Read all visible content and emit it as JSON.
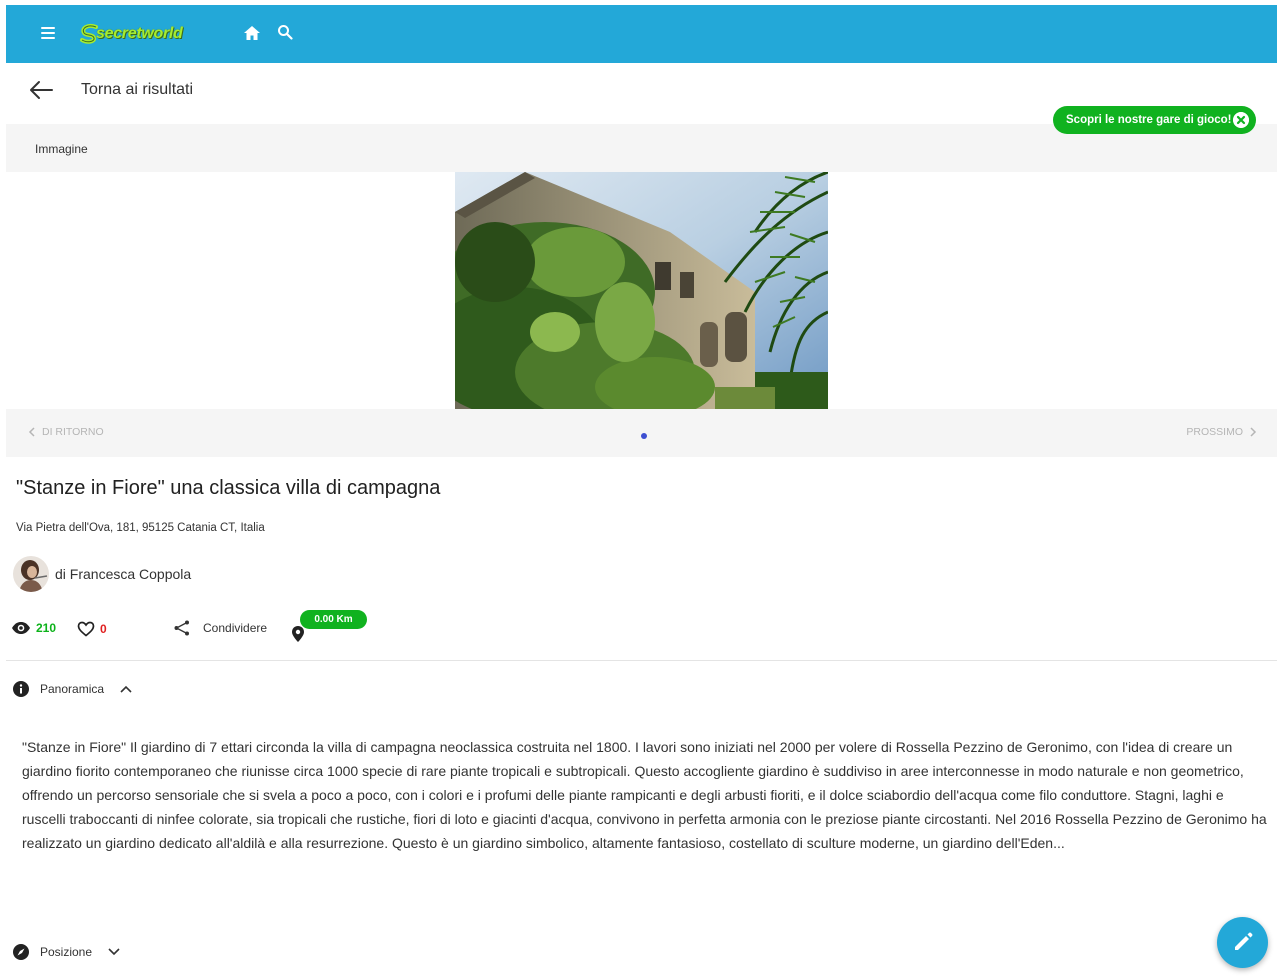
{
  "app": {
    "logo_text": "secretworld"
  },
  "header": {
    "icons": [
      "menu-icon",
      "home-icon",
      "search-icon"
    ]
  },
  "nav": {
    "back_label": "Torna ai risultati"
  },
  "promo": {
    "label": "Scopri le nostre gare di gioco!"
  },
  "gallery": {
    "title": "Immagine",
    "prev_label": "DI RITORNO",
    "next_label": "PROSSIMO",
    "image_alt": "Villa Stanze in Fiore"
  },
  "place": {
    "title": "\"Stanze in Fiore\" una classica villa di campagna",
    "address": "Via Pietra dell'Ova, 181, 95125 Catania CT, Italia",
    "author": "di Francesca Coppola"
  },
  "stats": {
    "views": "210",
    "likes": "0",
    "share_label": "Condividere",
    "distance": "0.00 Km"
  },
  "sections": {
    "overview_label": "Panoramica",
    "position_label": "Posizione",
    "description": "\"Stanze in Fiore\" Il giardino di 7 ettari circonda la villa di campagna neoclassica costruita nel 1800. I lavori sono iniziati nel 2000 per volere di Rossella Pezzino de Geronimo, con l'idea di creare un giardino fiorito contemporaneo che riunisse circa 1000 specie di rare piante tropicali e subtropicali. Questo accogliente giardino è suddiviso in aree interconnesse in modo naturale e non geometrico, offrendo un percorso sensoriale che si svela a poco a poco, con i colori e i profumi delle piante rampicanti e degli arbusti fioriti, e il dolce sciabordio dell'acqua come filo conduttore. Stagni, laghi e ruscelli traboccanti di ninfee colorate, sia tropicali che rustiche, fiori di loto e giacinti d'acqua, convivono in perfetta armonia con le preziose piante circostanti. Nel 2016 Rossella Pezzino de Geronimo ha realizzato un giardino dedicato all'aldilà e alla resurrezione. Questo è un giardino simbolico, altamente fantasioso, costellato di sculture moderne, un giardino dell'Eden..."
  },
  "colors": {
    "topbar": "#23a8d8",
    "accent_green": "#10b21f",
    "likes_red": "#e02020",
    "dot_blue": "#3d4fd1"
  }
}
